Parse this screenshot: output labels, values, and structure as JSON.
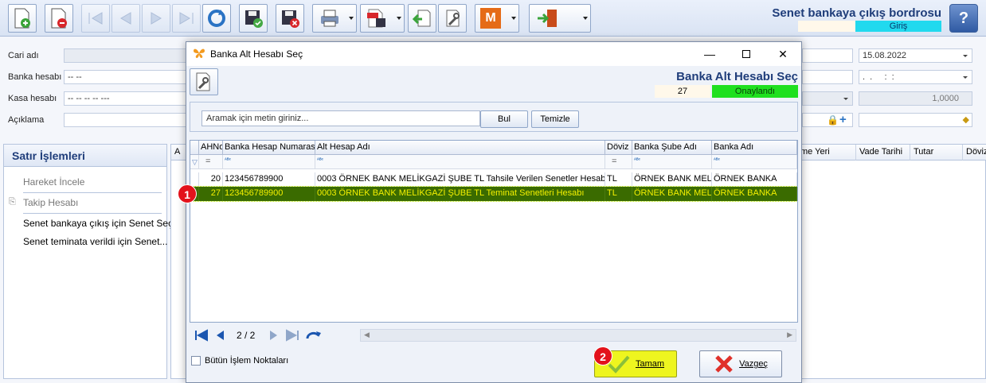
{
  "toolbar": {
    "form_title": "Senet bankaya çıkış bordrosu",
    "mode": "Giriş"
  },
  "form": {
    "cari_label": "Cari adı",
    "banka_label": "Banka hesabı",
    "banka_value": "-- --",
    "kasa_label": "Kasa hesabı",
    "kasa_value": "-- -- -- -- ---",
    "aciklama_label": "Açıklama",
    "date_value": "15.08.2022",
    "time_value": ".  .     :  :",
    "rate_value": "1,0000"
  },
  "left_panel": {
    "title": "Satır İşlemleri",
    "items": [
      "Hareket İncele",
      "Takip Hesabı",
      "Senet bankaya çıkış için Senet Seç",
      "Senet teminata verildi için Senet..."
    ]
  },
  "bg_grid": {
    "headers": [
      "A",
      "me Yeri",
      "Vade Tarihi",
      "Tutar",
      "Döviz"
    ]
  },
  "dialog": {
    "title": "Banka Alt Hesabı Seç",
    "heading": "Banka Alt Hesabı Seç",
    "count": "27",
    "status": "Onaylandı",
    "search_placeholder": "Aramak için metin giriniz...",
    "find_label": "Bul",
    "clear_label": "Temizle",
    "columns": [
      "AHNo",
      "Banka Hesap Numarası",
      "Alt Hesap Adı",
      "Döviz",
      "Banka Şube Adı",
      "Banka Adı"
    ],
    "rows": [
      {
        "no": "20",
        "account": "123456789900",
        "sub_name": "0003 ÖRNEK BANK MELİKGAZİ ŞUBE TL Tahsile Verilen Senetler Hesabı",
        "currency": "TL",
        "branch": "ÖRNEK BANK MELİK",
        "bank": "ÖRNEK BANKA"
      },
      {
        "no": "27",
        "account": "123456789900",
        "sub_name": "0003 ÖRNEK BANK MELİKGAZİ ŞUBE TL Teminat Senetleri Hesabı",
        "currency": "TL",
        "branch": "ÖRNEK BANK MELİK",
        "bank": "ÖRNEK BANKA"
      }
    ],
    "page_indicator": "2 / 2",
    "all_points_label": "Bütün İşlem Noktaları",
    "ok_label": "Tamam",
    "cancel_label": "Vazgeç"
  },
  "annotations": {
    "badge1": "1",
    "badge2": "2"
  },
  "colors": {
    "selected_row_bg": "#3a6b00",
    "selected_row_text": "#f4f000",
    "status_green": "#1fe01f",
    "mode_cyan": "#21d9ee",
    "ok_yellow": "#eef51f",
    "badge_red": "#e3121b"
  }
}
